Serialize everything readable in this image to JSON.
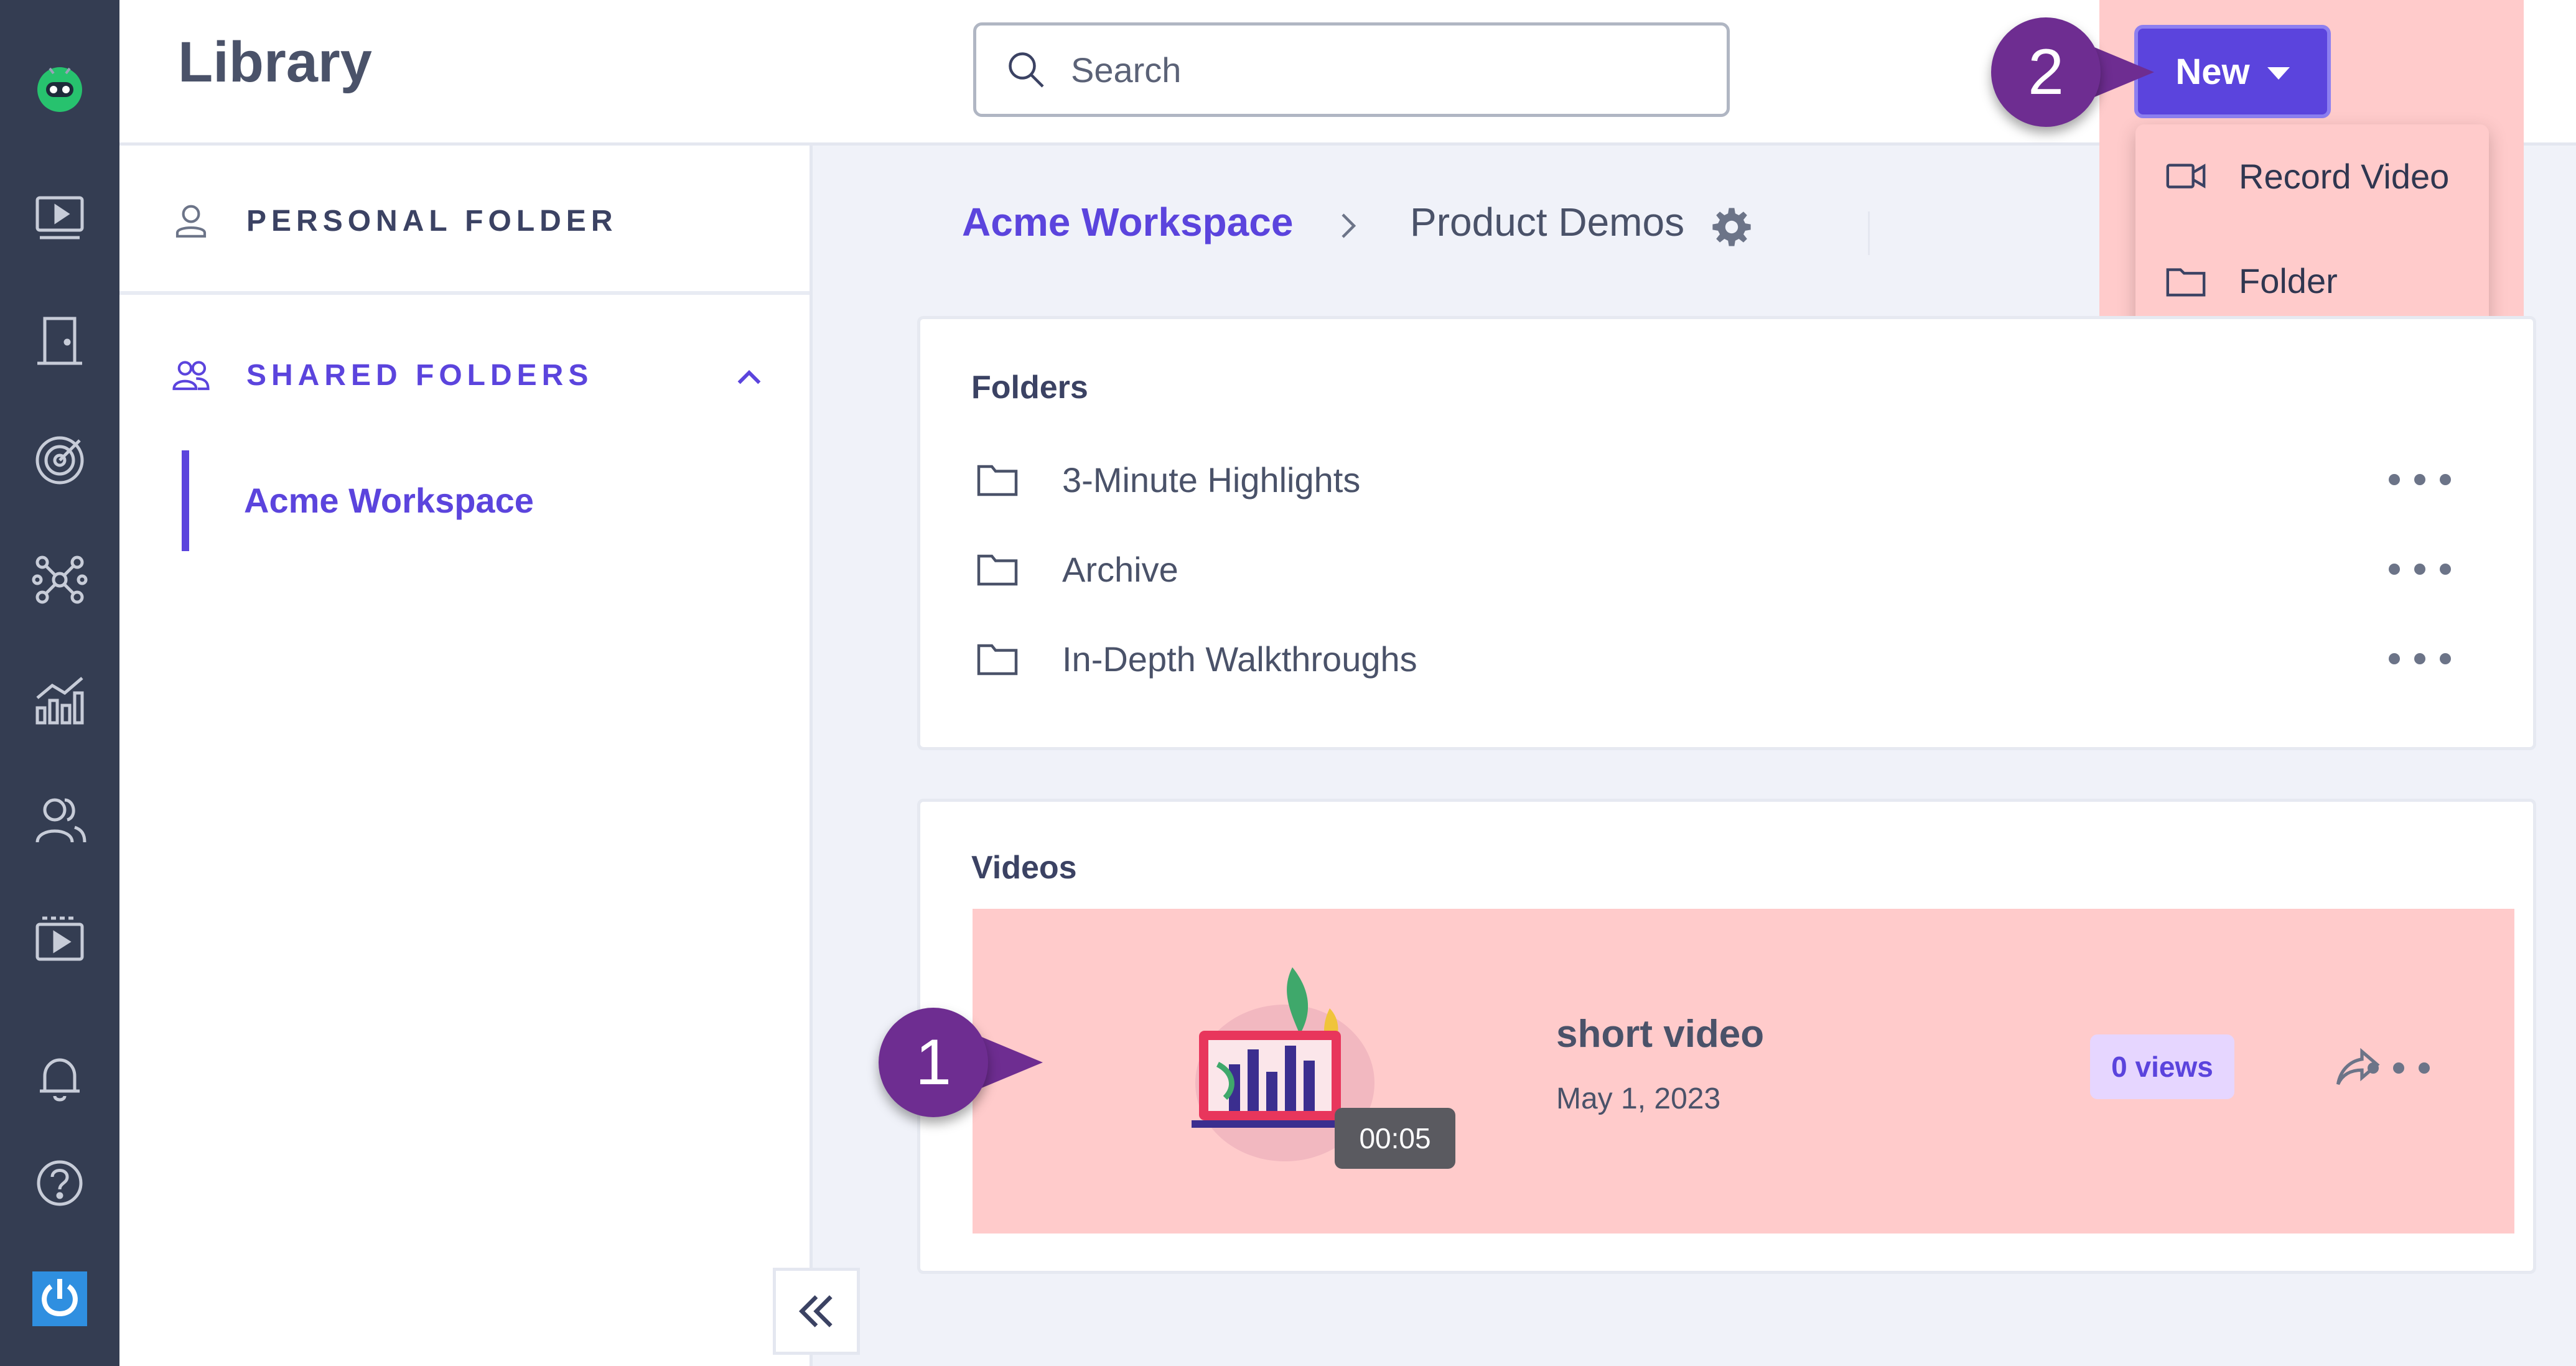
{
  "app": {
    "page_title": "Library"
  },
  "search": {
    "placeholder": "Search"
  },
  "header": {
    "new_button_label": "New",
    "new_menu": [
      {
        "label": "Record Video",
        "icon": "video-camera-icon"
      },
      {
        "label": "Folder",
        "icon": "folder-icon"
      }
    ]
  },
  "annotations": {
    "step1": "1",
    "step2": "2"
  },
  "sidebar_rail": {
    "icons": [
      "logo-icon",
      "screen-play-icon",
      "door-icon",
      "target-icon",
      "network-icon",
      "analytics-icon",
      "users-icon",
      "video-library-icon",
      "bell-icon",
      "help-icon",
      "power-icon"
    ]
  },
  "left_panel": {
    "personal_folder": "PERSONAL FOLDER",
    "shared_folders": "SHARED FOLDERS",
    "workspace": "Acme Workspace"
  },
  "breadcrumb": {
    "workspace": "Acme Workspace",
    "current": "Product Demos"
  },
  "folders": {
    "heading": "Folders",
    "items": [
      {
        "name": "3-Minute Highlights"
      },
      {
        "name": "Archive"
      },
      {
        "name": "In-Depth Walkthroughs"
      }
    ]
  },
  "videos": {
    "heading": "Videos",
    "items": [
      {
        "title": "short video",
        "date": "May 1, 2023",
        "duration": "00:05",
        "views": "0 views"
      }
    ]
  },
  "colors": {
    "rail_bg": "#343d52",
    "accent": "#5b44dd",
    "highlight": "#ffcbcb",
    "step_badge": "#6e2d91"
  }
}
